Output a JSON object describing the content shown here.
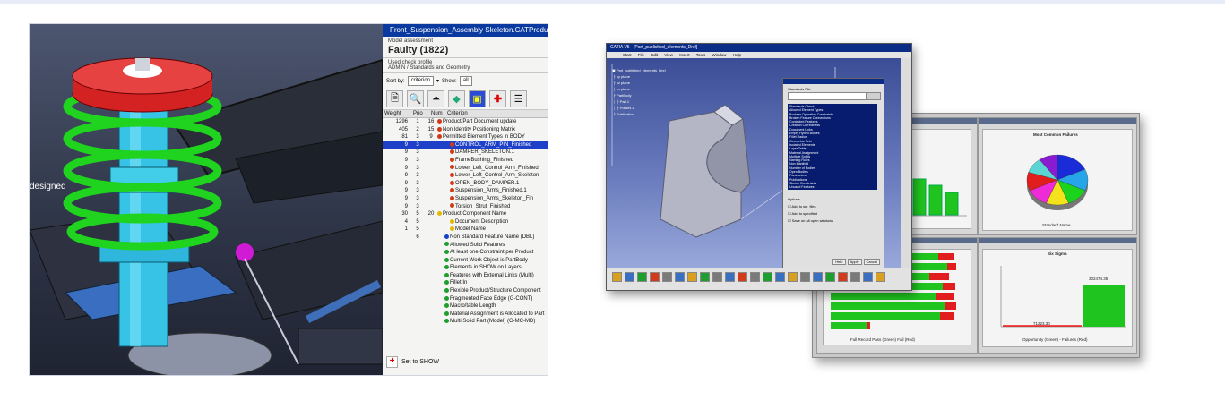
{
  "left_screenshot": {
    "viewport_label": "designed",
    "panel": {
      "title": "Front_Suspension_Assembly Skeleton.CATProduct",
      "model_assessment_label": "Model assessment",
      "status": "Faulty (1822)",
      "check_profile_label": "Used check profile",
      "check_profile": "ADMIN / Standards and Geometry",
      "sort_by_label": "Sort by:",
      "sort_by_value": "criterion",
      "show_label": "Show:",
      "show_value": "all",
      "columns": [
        "Weight",
        "Prio",
        "Num",
        "Criterion"
      ],
      "rows": [
        {
          "weight": "1296",
          "prio": "1",
          "num": "16",
          "label": "Product/Part Document update",
          "dot": "#d23a1a",
          "highlight": false
        },
        {
          "weight": "405",
          "prio": "2",
          "num": "15",
          "label": "Non Identity Positioning Matrix",
          "dot": "#d23a1a",
          "highlight": false
        },
        {
          "weight": "81",
          "prio": "3",
          "num": "9",
          "label": "Permitted Element Types in BODY",
          "dot": "#d23a1a",
          "highlight": false
        },
        {
          "weight": "9",
          "prio": "3",
          "num": "",
          "label": "CONTROL_ARM_PIN_Finished",
          "dot": "#d23a1a",
          "highlight": true
        },
        {
          "weight": "9",
          "prio": "3",
          "num": "",
          "label": "DAMPER_SKELETON.1",
          "dot": "#d23a1a",
          "highlight": false
        },
        {
          "weight": "9",
          "prio": "3",
          "num": "",
          "label": "FrameBushing_Finished",
          "dot": "#d23a1a",
          "highlight": false
        },
        {
          "weight": "9",
          "prio": "3",
          "num": "",
          "label": "Lower_Left_Control_Arm_Finished",
          "dot": "#d23a1a",
          "highlight": false
        },
        {
          "weight": "9",
          "prio": "3",
          "num": "",
          "label": "Lower_Left_Control_Arm_Skeleton",
          "dot": "#d23a1a",
          "highlight": false
        },
        {
          "weight": "9",
          "prio": "3",
          "num": "",
          "label": "OPEN_BODY_DAMPER.1",
          "dot": "#d23a1a",
          "highlight": false
        },
        {
          "weight": "9",
          "prio": "3",
          "num": "",
          "label": "Suspension_Arms_Finished.1",
          "dot": "#d23a1a",
          "highlight": false
        },
        {
          "weight": "9",
          "prio": "3",
          "num": "",
          "label": "Suspension_Arms_Skeleton_Fin",
          "dot": "#d23a1a",
          "highlight": false
        },
        {
          "weight": "9",
          "prio": "3",
          "num": "",
          "label": "Torsion_Strut_Finished",
          "dot": "#d23a1a",
          "highlight": false
        },
        {
          "weight": "30",
          "prio": "5",
          "num": "20",
          "label": "Product Component Name",
          "dot": "#e6b800",
          "highlight": false
        },
        {
          "weight": "4",
          "prio": "5",
          "num": "",
          "label": "Document Description",
          "dot": "#e6b800",
          "highlight": false
        },
        {
          "weight": "1",
          "prio": "5",
          "num": "",
          "label": "Model Name",
          "dot": "#e6b800",
          "highlight": false
        },
        {
          "weight": "",
          "prio": "6",
          "num": "",
          "label": "Non Standard Feature Name (DBL)",
          "dot": "#1540c8",
          "highlight": false
        },
        {
          "weight": "",
          "prio": "",
          "num": "",
          "label": "Allowed Solid Features",
          "dot": "#1e9e2e",
          "highlight": false
        },
        {
          "weight": "",
          "prio": "",
          "num": "",
          "label": "At least one Constraint per Product",
          "dot": "#1e9e2e",
          "highlight": false
        },
        {
          "weight": "",
          "prio": "",
          "num": "",
          "label": "Current Work Object is PartBody",
          "dot": "#1e9e2e",
          "highlight": false
        },
        {
          "weight": "",
          "prio": "",
          "num": "",
          "label": "Elements in SHOW on Layers",
          "dot": "#1e9e2e",
          "highlight": false
        },
        {
          "weight": "",
          "prio": "",
          "num": "",
          "label": "Features with External Links (Multi)",
          "dot": "#1e9e2e",
          "highlight": false
        },
        {
          "weight": "",
          "prio": "",
          "num": "",
          "label": "Fillet In",
          "dot": "#1e9e2e",
          "highlight": false
        },
        {
          "weight": "",
          "prio": "",
          "num": "",
          "label": "Flexible Product/Structure Component",
          "dot": "#1e9e2e",
          "highlight": false
        },
        {
          "weight": "",
          "prio": "",
          "num": "",
          "label": "Fragmented Face Edge (G-CONT)",
          "dot": "#1e9e2e",
          "highlight": false
        },
        {
          "weight": "",
          "prio": "",
          "num": "",
          "label": "Macro/table Length",
          "dot": "#1e9e2e",
          "highlight": false
        },
        {
          "weight": "",
          "prio": "",
          "num": "",
          "label": "Material Assignment is Allocated to Part",
          "dot": "#1e9e2e",
          "highlight": false
        },
        {
          "weight": "",
          "prio": "",
          "num": "",
          "label": "Multi Solid Part (Model) (G-MC-MD)",
          "dot": "#1e9e2e",
          "highlight": false
        }
      ],
      "set_to_show": "Set to SHOW"
    }
  },
  "right_screenshot": {
    "front_title": "CATIA V5 - [Part_published_elements_Drel]",
    "menu": [
      "Start",
      "File",
      "Edit",
      "View",
      "Insert",
      "Tools",
      "Window",
      "Help"
    ],
    "dialog_list_top": "Standards File",
    "dialog_list_items": [
      "Standards Check",
      "Allowed Element Types",
      "Boolean Operation Constraints",
      "Broken Feature Connections",
      "Contacted Features",
      "Creation Correctness",
      "Document Links",
      "Empty Hybrid Bodies",
      "Fillet Radius",
      "Geometric Sets",
      "Isolated Elements",
      "Layer Table",
      "Material Assignment",
      "Multiple Solids",
      "Naming Rules",
      "Non Manifold",
      "Number of Bodies",
      "Open Bodies",
      "Parameters",
      "Publications",
      "Sketch Constraints",
      "Unused Features"
    ],
    "dialog_options_label": "Options",
    "dialog_checkboxes": [
      "Add to sel. files",
      "Add to specified",
      "Save on all open windows"
    ],
    "dialog_buttons": [
      "Help",
      "Apply",
      "Cancel"
    ],
    "pie_title": "Most Common Failures",
    "six_sigma_title": "Six Sigma",
    "six_sigma_xlabel": "Opportunity (Green) - Failures (Red)",
    "six_sigma_value": "302474.35",
    "six_sigma_low": "71223.30",
    "bar_footer": "Full Record   Pass (Green)   Fail (Red)",
    "pie_footer": "Standard Name",
    "pie_colors": [
      "#1a2bd8",
      "#26a5e8",
      "#1bd31b",
      "#f4e21a",
      "#ef2bd8",
      "#e11d1d",
      "#5bd4d4",
      "#8a1bd0"
    ],
    "pie_values": [
      0.18,
      0.14,
      0.12,
      0.12,
      0.12,
      0.12,
      0.1,
      0.1
    ]
  }
}
